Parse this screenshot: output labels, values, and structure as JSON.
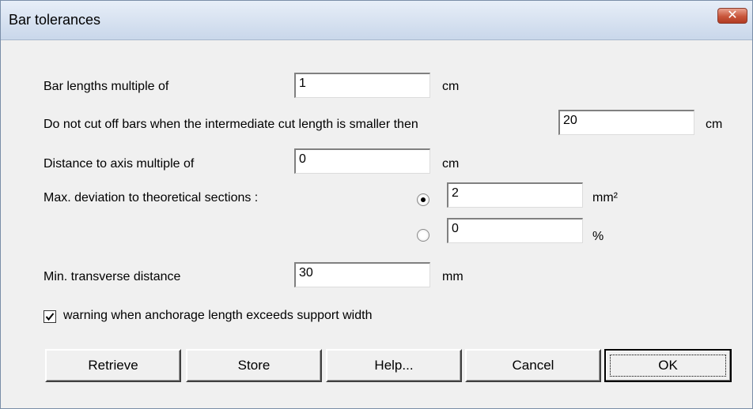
{
  "window": {
    "title": "Bar tolerances",
    "close_icon": "close-icon"
  },
  "fields": {
    "bar_lengths": {
      "label": "Bar lengths multiple of",
      "value": "1",
      "unit": "cm"
    },
    "cut_off": {
      "label": "Do not cut off bars when the intermediate cut length is smaller then",
      "value": "20",
      "unit": "cm"
    },
    "axis_distance": {
      "label": "Distance to axis multiple of",
      "value": "0",
      "unit": "cm"
    },
    "max_deviation": {
      "label": "Max. deviation to theoretical sections :",
      "option_mm2": {
        "value": "2",
        "unit": "mm²",
        "selected": true
      },
      "option_pct": {
        "value": "0",
        "unit": "%",
        "selected": false
      }
    },
    "transverse": {
      "label": "Min. transverse distance",
      "value": "30",
      "unit": "mm"
    }
  },
  "warning": {
    "label": "warning when anchorage length exceeds support width",
    "checked": true
  },
  "buttons": {
    "retrieve": "Retrieve",
    "store": "Store",
    "help": "Help...",
    "cancel": "Cancel",
    "ok": "OK"
  }
}
